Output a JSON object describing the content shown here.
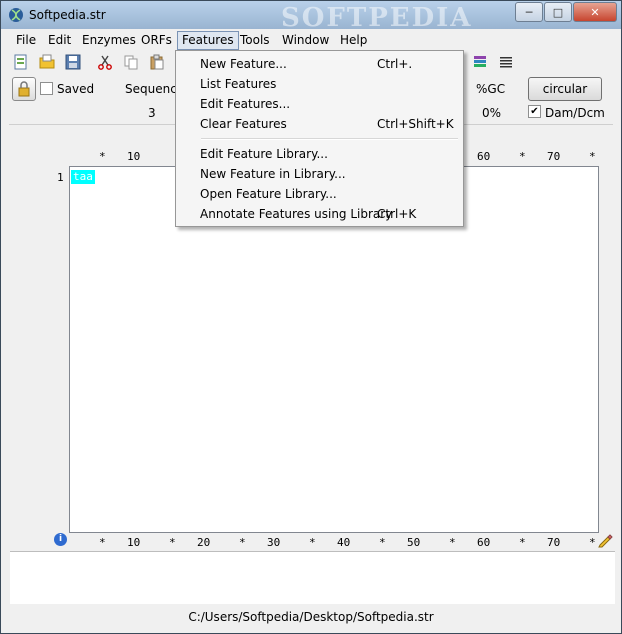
{
  "window": {
    "title": "Softpedia.str",
    "watermark": "SOFTPEDIA",
    "minimize_glyph": "─",
    "maximize_glyph": "□",
    "close_glyph": "✕"
  },
  "menubar": {
    "items": [
      "File",
      "Edit",
      "Enzymes",
      "ORFs",
      "Features",
      "Tools",
      "Window",
      "Help"
    ],
    "active": "Features"
  },
  "info": {
    "saved_label": "Saved",
    "sequence_label": "Sequence",
    "sequence_value": "3",
    "gc_label": "%GC",
    "gc_value": "0%",
    "circular_button": "circular",
    "dam_dcm_label": "Dam/Dcm",
    "dam_dcm_checked": true,
    "saved_checked": false
  },
  "ruler": {
    "marks": [
      "*",
      "10",
      "*",
      "20",
      "*",
      "30",
      "*",
      "40",
      "*",
      "50",
      "*",
      "60",
      "*",
      "70",
      "*"
    ],
    "top_visible": [
      "*",
      "10",
      "60",
      "*",
      "70",
      "*"
    ]
  },
  "sequence": {
    "row_number": "1",
    "text": "taa"
  },
  "features_menu": {
    "items": [
      {
        "label": "New Feature...",
        "shortcut": "Ctrl+."
      },
      {
        "label": "List Features",
        "shortcut": ""
      },
      {
        "label": "Edit Features...",
        "shortcut": ""
      },
      {
        "label": "Clear Features",
        "shortcut": "Ctrl+Shift+K"
      },
      {
        "label": "Edit Feature Library...",
        "shortcut": ""
      },
      {
        "label": "New Feature in Library...",
        "shortcut": ""
      },
      {
        "label": "Open Feature Library...",
        "shortcut": ""
      },
      {
        "label": "Annotate Features using Library",
        "shortcut": "Ctrl+K"
      }
    ]
  },
  "status": {
    "path": "C:/Users/Softpedia/Desktop/Softpedia.str"
  },
  "icons": {
    "app": "dna-app-icon",
    "info": "info-icon",
    "edit": "pencil-icon",
    "lock": "lock-icon"
  }
}
